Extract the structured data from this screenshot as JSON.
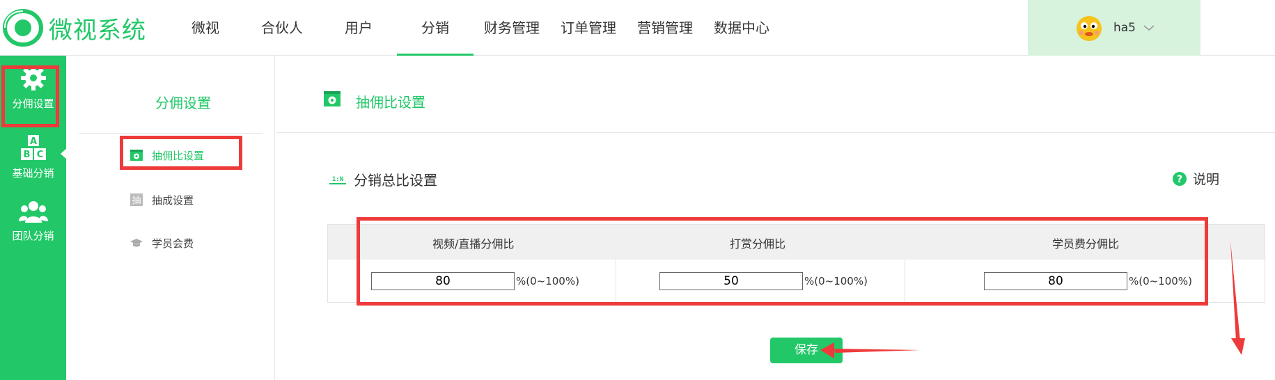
{
  "logo": {
    "text": "微视系统",
    "icon": "eye-logo-icon"
  },
  "nav": {
    "items": [
      {
        "label": "微视"
      },
      {
        "label": "合伙人"
      },
      {
        "label": "用户"
      },
      {
        "label": "分销",
        "active": true
      },
      {
        "label": "财务管理"
      },
      {
        "label": "订单管理"
      },
      {
        "label": "营销管理"
      },
      {
        "label": "数据中心"
      }
    ]
  },
  "user": {
    "name": "ha5",
    "avatar_icon": "cartoon-avatar-icon",
    "dropdown_icon": "chevron-down-icon"
  },
  "rail": {
    "items": [
      {
        "label": "分佣设置",
        "icon": "gear-icon",
        "active": true
      },
      {
        "label": "基础分销",
        "icon": "abc-blocks-icon"
      },
      {
        "label": "团队分销",
        "icon": "team-icon"
      }
    ]
  },
  "secnav": {
    "title": "分佣设置",
    "items": [
      {
        "label": "抽佣比设置",
        "icon": "settings-window-icon",
        "active": true
      },
      {
        "label": "抽成设置",
        "icon": "chou-char-icon"
      },
      {
        "label": "学员会费",
        "icon": "graduation-cap-icon"
      }
    ]
  },
  "main": {
    "heading": "抽佣比设置",
    "section_title": "分销总比设置",
    "section_icon": "one-to-n-icon",
    "help_label": "说明",
    "table": {
      "headers": [
        "视频/直播分佣比",
        "打赏分佣比",
        "学员费分佣比"
      ],
      "values": [
        "80",
        "50",
        "80"
      ],
      "unit": "%(0~100%)"
    },
    "save_label": "保存"
  },
  "colors": {
    "brand": "#22c868",
    "annotation": "#ee3a3a",
    "user_bg": "#d7f3de"
  }
}
